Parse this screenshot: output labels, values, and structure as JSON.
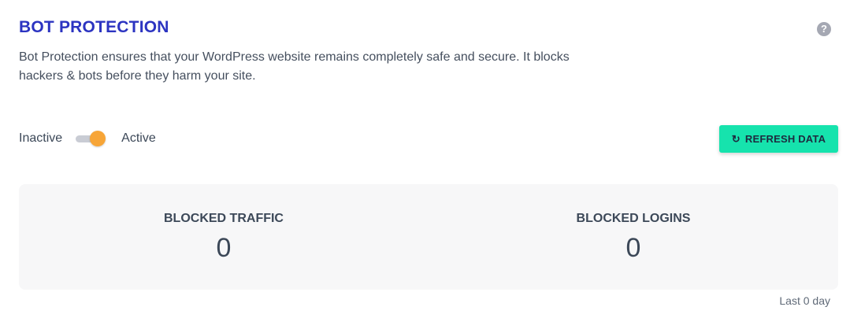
{
  "header": {
    "title": "BOT PROTECTION",
    "help_icon": "question-circle-icon",
    "help_glyph": "?",
    "description": "Bot Protection ensures that your WordPress website remains completely safe and secure. It blocks hackers & bots before they harm your site."
  },
  "toggle": {
    "inactive_label": "Inactive",
    "active_label": "Active",
    "state": "active"
  },
  "refresh": {
    "icon": "refresh-icon",
    "glyph": "↻",
    "label": "REFRESH DATA"
  },
  "stats": [
    {
      "label": "BLOCKED TRAFFIC",
      "value": "0"
    },
    {
      "label": "BLOCKED LOGINS",
      "value": "0"
    }
  ],
  "footer": {
    "period": "Last 0 day"
  },
  "colors": {
    "title": "#2c34c1",
    "accent_button": "#16e3ad",
    "toggle_knob": "#f7a537",
    "stats_background": "#f7f7f8"
  }
}
